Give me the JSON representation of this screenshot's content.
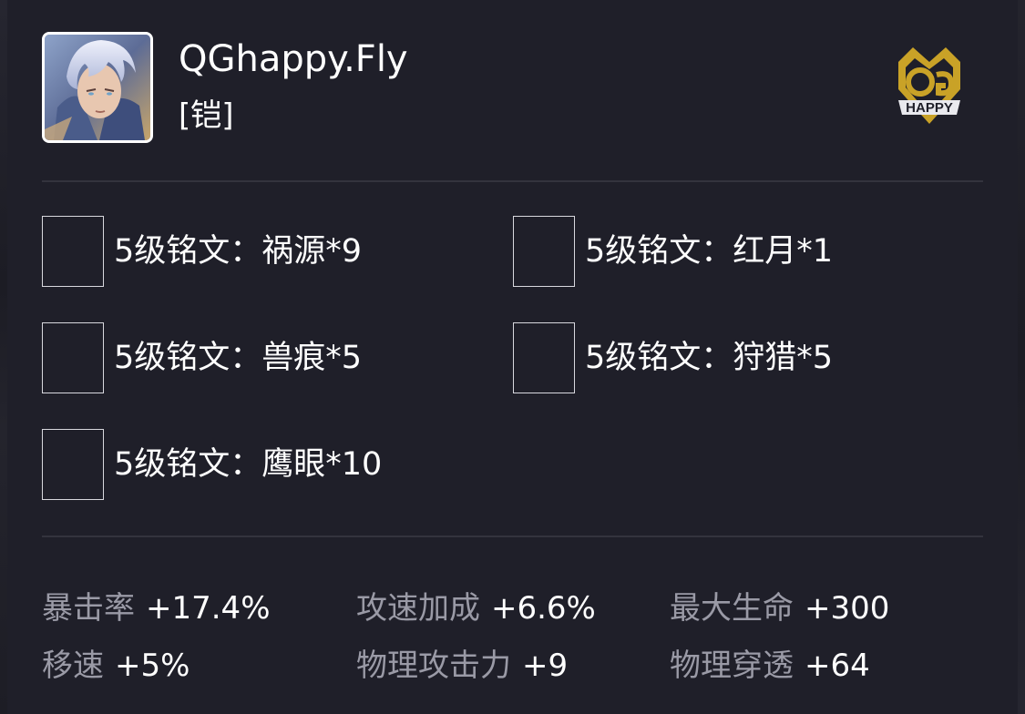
{
  "header": {
    "player_name": "QGhappy.Fly",
    "role": "[铠]",
    "avatar_icon": "hero-portrait",
    "team_logo_icon": "qghappy-team-logo",
    "team_logo_text": "HAPPY"
  },
  "colors": {
    "background": "#1f1f29",
    "divider": "#33333d",
    "stat_label": "#9a9aa6",
    "text": "#ffffff",
    "logo_gold": "#c9a227"
  },
  "runes": [
    {
      "label": "5级铭文：祸源*9"
    },
    {
      "label": "5级铭文：红月*1"
    },
    {
      "label": "5级铭文：兽痕*5"
    },
    {
      "label": "5级铭文：狩猎*5"
    },
    {
      "label": "5级铭文：鹰眼*10"
    }
  ],
  "stats": [
    {
      "label": "暴击率",
      "value": "+17.4%"
    },
    {
      "label": "攻速加成",
      "value": "+6.6%"
    },
    {
      "label": "最大生命",
      "value": "+300"
    },
    {
      "label": "移速",
      "value": "+5%"
    },
    {
      "label": "物理攻击力",
      "value": "+9"
    },
    {
      "label": "物理穿透",
      "value": "+64"
    }
  ]
}
